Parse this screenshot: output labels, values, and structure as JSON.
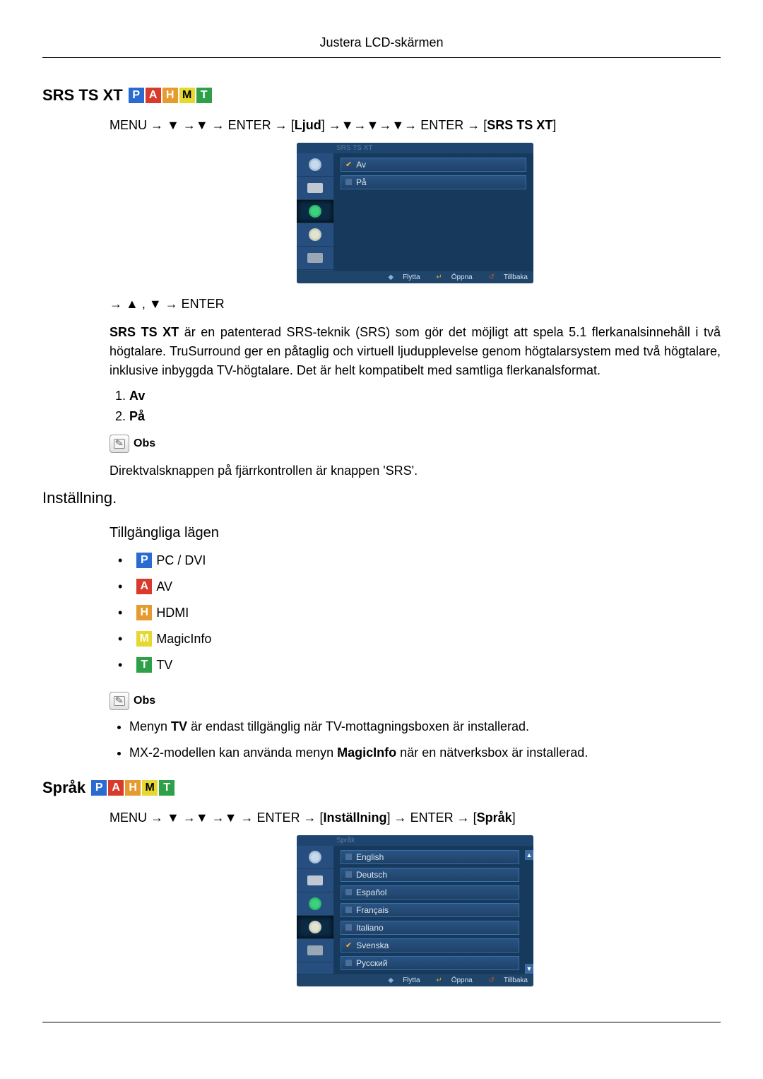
{
  "header": "Justera LCD-skärmen",
  "srs": {
    "title": "SRS TS XT",
    "modes": [
      "P",
      "A",
      "H",
      "M",
      "T"
    ],
    "path_parts": {
      "menu": "MENU",
      "enter": "ENTER",
      "group": "Ljud",
      "target": "SRS TS XT"
    },
    "osd": {
      "title": "SRS TS XT",
      "options": [
        {
          "label": "Av",
          "checked": true
        },
        {
          "label": "På",
          "checked": false
        }
      ],
      "footer": {
        "flytta": "Flytta",
        "oppna": "Öppna",
        "tillbaka": "Tillbaka"
      }
    },
    "after_path": "→ ▲ , ▼ → ENTER",
    "desc_prefix": "SRS TS XT",
    "desc": " är en patenterad SRS-teknik (SRS) som gör det möjligt att spela 5.1 flerkanal­sinnehåll i två högtalare. TruSurround ger en påtaglig och virtuell ljudupplevelse genom högtalarsystem med två högtalare, inklusive inbyggda TV-högtalare. Det är helt kompatibelt med samtliga flerkanalsformat.",
    "list": [
      "Av",
      "På"
    ],
    "obs_label": "Obs",
    "obs_text": "Direktvalsknappen på fjärrkontrollen är knappen 'SRS'."
  },
  "install": {
    "title": "Inställning.",
    "sub": "Tillgängliga lägen",
    "modes_list": [
      {
        "box": "P",
        "cls": "mode-P",
        "label": "PC / DVI"
      },
      {
        "box": "A",
        "cls": "mode-A",
        "label": "AV"
      },
      {
        "box": "H",
        "cls": "mode-H",
        "label": "HDMI"
      },
      {
        "box": "M",
        "cls": "mode-M",
        "label": "MagicInfo"
      },
      {
        "box": "T",
        "cls": "mode-T",
        "label": "TV"
      }
    ],
    "obs_label": "Obs",
    "notes_pre1a": "Menyn ",
    "notes_bold1": "TV",
    "notes_post1": " är endast tillgänglig när TV-mottagningsboxen är installerad.",
    "notes_pre2": "MX-2-modellen kan använda menyn ",
    "notes_bold2": "MagicInfo",
    "notes_post2": " när en nätverksbox är installerad."
  },
  "sprak": {
    "title": "Språk",
    "modes": [
      "P",
      "A",
      "H",
      "M",
      "T"
    ],
    "path_parts": {
      "menu": "MENU",
      "enter": "ENTER",
      "group": "Inställning",
      "target": "Språk"
    },
    "osd": {
      "title": "Språk",
      "options": [
        {
          "label": "English",
          "checked": false
        },
        {
          "label": "Deutsch",
          "checked": false
        },
        {
          "label": "Español",
          "checked": false
        },
        {
          "label": "Français",
          "checked": false
        },
        {
          "label": "Italiano",
          "checked": false
        },
        {
          "label": "Svenska",
          "checked": true
        },
        {
          "label": "Русский",
          "checked": false
        }
      ],
      "footer": {
        "flytta": "Flytta",
        "oppna": "Öppna",
        "tillbaka": "Tillbaka"
      }
    }
  }
}
